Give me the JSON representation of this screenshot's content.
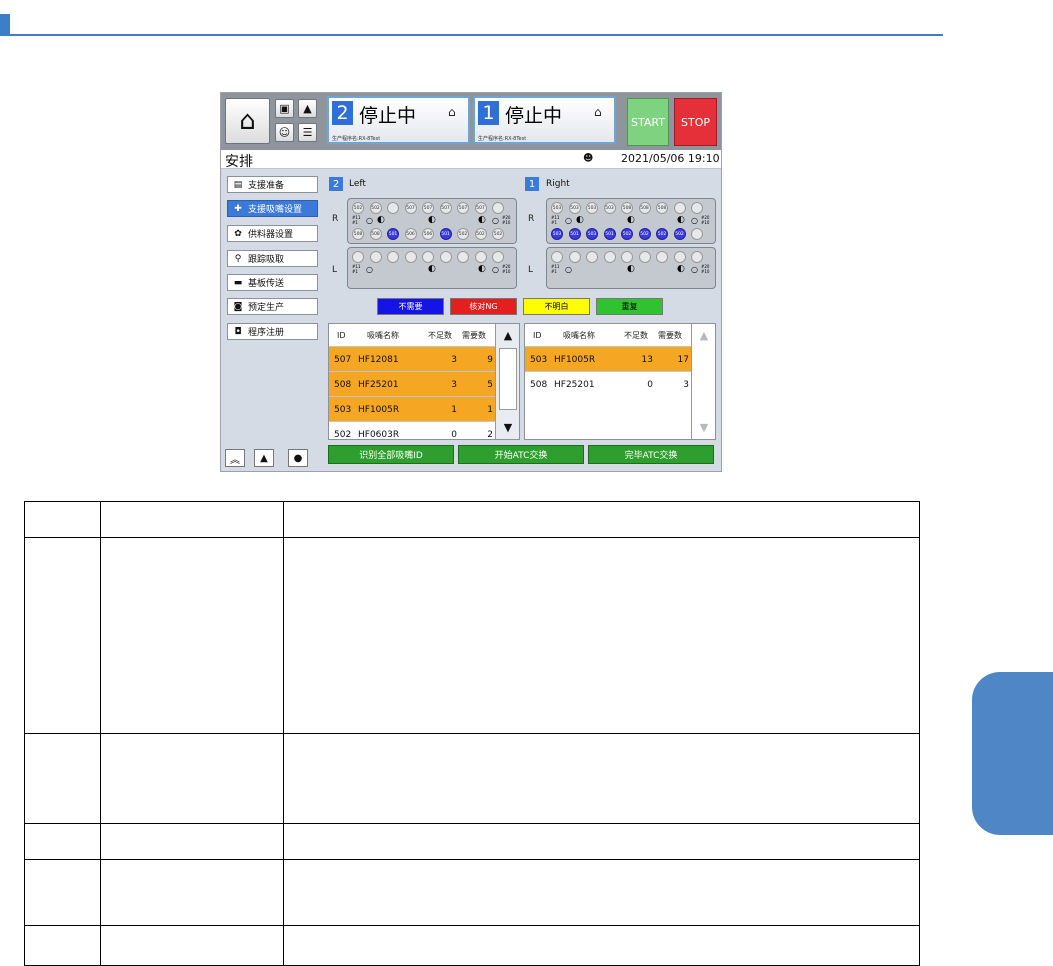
{
  "topbar": {
    "lanes": [
      {
        "num": "2",
        "status": "停止中",
        "program": "生产程序名:RX-8Test"
      },
      {
        "num": "1",
        "status": "停止中",
        "program": "生产程序名:RX-8Test"
      }
    ],
    "start_label": "START",
    "stop_label": "STOP"
  },
  "screen": {
    "title": "安排",
    "datetime": "2021/05/06 19:10"
  },
  "sidebar": {
    "items": [
      {
        "label": "支援准备",
        "icon": "list-icon"
      },
      {
        "label": "支援吸嘴设置",
        "icon": "nozzle-icon"
      },
      {
        "label": "供料器设置",
        "icon": "feeder-icon"
      },
      {
        "label": "跟踪吸取",
        "icon": "tracking-icon"
      },
      {
        "label": "基板传送",
        "icon": "board-icon"
      },
      {
        "label": "预定生产",
        "icon": "schedule-icon"
      },
      {
        "label": "程序注册",
        "icon": "program-icon"
      }
    ]
  },
  "heads": [
    {
      "num": "2",
      "label": "Left",
      "r_top": [
        "502",
        "502",
        "",
        "507",
        "507",
        "507",
        "507",
        "507"
      ],
      "r_bottom": [
        "508",
        "508",
        "501",
        "506",
        "506",
        "501",
        "502",
        "502",
        "502"
      ],
      "r_bottom_blue": [
        2,
        5
      ],
      "left_marks": [
        "#11",
        "#1"
      ],
      "right_marks": [
        "#20",
        "#10"
      ]
    },
    {
      "num": "1",
      "label": "Right",
      "r_top": [
        "503",
        "503",
        "503",
        "503",
        "508",
        "508",
        "508",
        ""
      ],
      "r_bottom": [
        "503",
        "501",
        "503",
        "501",
        "502",
        "502",
        "502",
        "502",
        ""
      ],
      "r_bottom_blue": [
        0,
        1,
        2,
        3,
        4,
        5,
        6,
        7
      ],
      "left_marks": [
        "#11",
        "#1"
      ],
      "right_marks": [
        "#20",
        "#10"
      ]
    }
  ],
  "row_labels": {
    "r": "R",
    "l": "L"
  },
  "legend": [
    {
      "label": "不需要",
      "bg": "#1414e6",
      "fg": "#ffffff"
    },
    {
      "label": "核对NG",
      "bg": "#e51f1f",
      "fg": "#ffffff"
    },
    {
      "label": "不明白",
      "bg": "#ffff00",
      "fg": "#000000"
    },
    {
      "label": "重复",
      "bg": "#2fc42f",
      "fg": "#000000"
    }
  ],
  "table_headers": {
    "id": "ID",
    "name": "吸嘴名称",
    "short": "不足数",
    "need": "需要数"
  },
  "left_table": [
    {
      "id": "507",
      "name": "HF12081",
      "short": "3",
      "need": "9",
      "highlight": true
    },
    {
      "id": "508",
      "name": "HF25201",
      "short": "3",
      "need": "5",
      "highlight": true
    },
    {
      "id": "503",
      "name": "HF1005R",
      "short": "1",
      "need": "1",
      "highlight": true
    },
    {
      "id": "502",
      "name": "HF0603R",
      "short": "0",
      "need": "2",
      "highlight": false
    }
  ],
  "right_table": [
    {
      "id": "503",
      "name": "HF1005R",
      "short": "13",
      "need": "17",
      "highlight": true
    },
    {
      "id": "508",
      "name": "HF25201",
      "short": "0",
      "need": "3",
      "highlight": false
    }
  ],
  "actions": {
    "identify": "识别全部吸嘴ID",
    "start_atc": "开始ATC交换",
    "finish_atc": "完毕ATC交换"
  },
  "colors": {
    "accent": "#3d7fc4",
    "selected": "#3c7ad9",
    "highlight_row": "#f5a623",
    "start": "#7fd27f",
    "stop": "#e5303a"
  }
}
